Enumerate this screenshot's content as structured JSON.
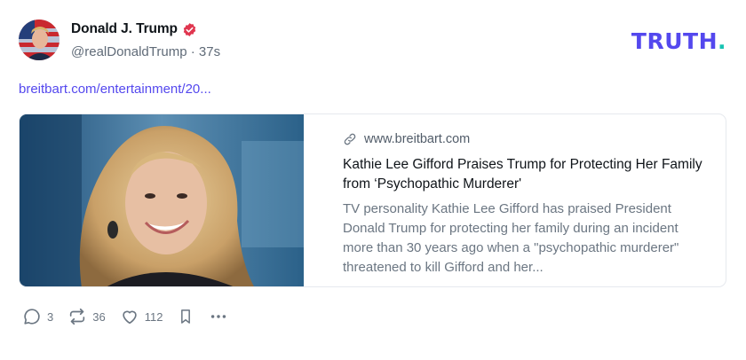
{
  "post": {
    "author": {
      "display_name": "Donald J. Trump",
      "handle": "@realDonaldTrump",
      "time": "37s",
      "verified": true
    },
    "brand": {
      "logo_text": "TRUTH",
      "logo_dot": "."
    },
    "link_text": "breitbart.com/entertainment/20...",
    "card": {
      "domain": "www.breitbart.com",
      "title": "Kathie Lee Gifford Praises Trump for Protecting Her Family from ‘Psychopathic Murderer'",
      "description": "TV personality Kathie Lee Gifford has praised President Donald Trump for protecting her family during an incident more than 30 years ago when a \"psychopathic murderer\" threatened to kill Gifford and her..."
    },
    "actions": {
      "replies": "3",
      "retruths": "36",
      "likes": "112"
    }
  },
  "icons": {
    "verified": "verified-badge-icon",
    "link": "link-icon",
    "reply": "reply-icon",
    "retruth": "retruth-icon",
    "like": "heart-icon",
    "bookmark": "bookmark-icon",
    "more": "more-icon"
  },
  "colors": {
    "brand_purple": "#5448ee",
    "brand_teal": "#17c3b2",
    "verified_red": "#e0364f",
    "muted_text": "#606b78"
  }
}
